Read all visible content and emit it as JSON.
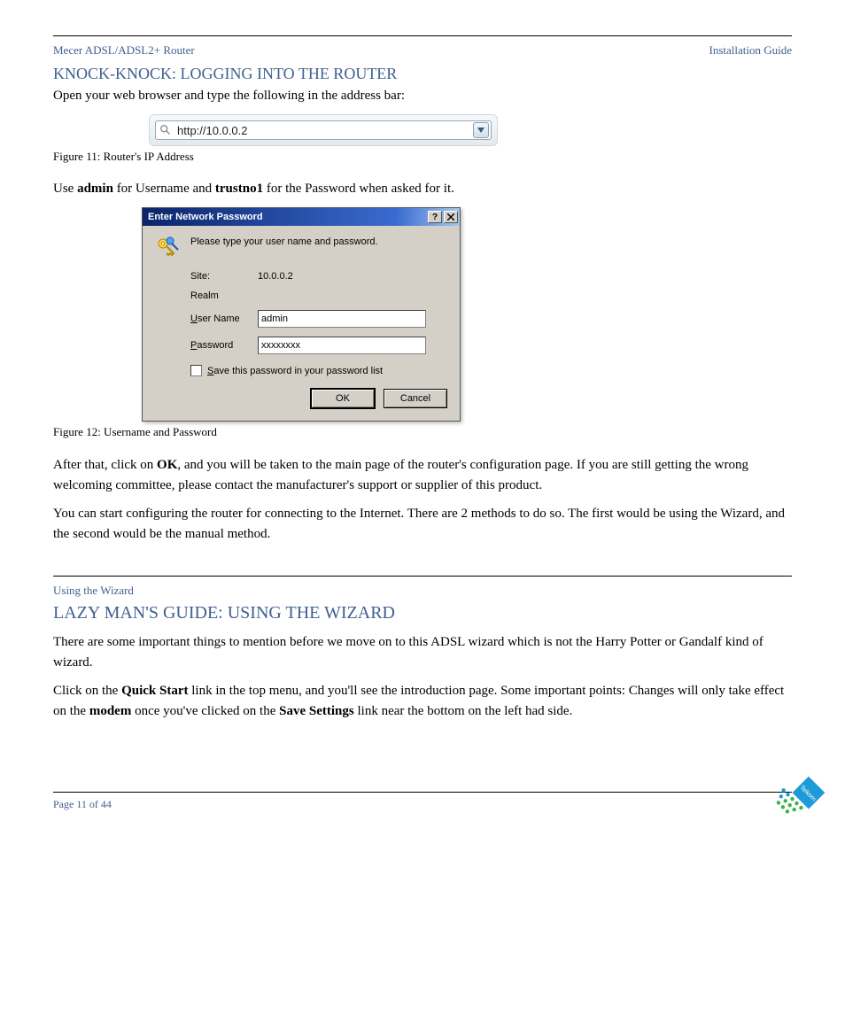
{
  "header": {
    "product": "Mecer ADSL/ADSL2+ Router",
    "doc_type": "Installation Guide"
  },
  "section1": {
    "title": "KNOCK-KNOCK: LOGGING INTO THE ROUTER",
    "intro": "Open your web browser and type the following in the address bar:",
    "addr_url": "http://10.0.0.2",
    "addr_caption": "Figure 11: Router's IP Address",
    "prompt_line_prefix": "Use ",
    "prompt_line_bold1": "admin",
    "prompt_line_mid": " for Username and ",
    "prompt_line_bold2": "trustno1",
    "prompt_line_suffix": " for the Password when asked for it.",
    "dialog": {
      "title": "Enter Network Password",
      "instruction": "Please type your user name and password.",
      "site_label": "Site:",
      "site_value": "10.0.0.2",
      "realm_label": "Realm",
      "user_label": "User Name",
      "user_value": "admin",
      "pass_label": "Password",
      "pass_value": "xxxxxxxx",
      "save_label": "Save this password in your password list",
      "ok": "OK",
      "cancel": "Cancel"
    },
    "dlg_caption": "Figure 12: Username and Password",
    "para_after_prefix": "After that, click on ",
    "para_after_bold": "OK",
    "para_after_suffix": ", and you will be taken to the main page of the router's configuration page. If you are still getting the wrong welcoming committee, please contact the manufacturer's support or supplier of this product.",
    "para2": "You can start configuring the router for connecting to the Internet. There are 2 methods to do so. The first would be using the Wizard, and the second would be the manual method."
  },
  "section2": {
    "kicker": "Using the Wizard",
    "title": "LAZY MAN'S GUIDE: USING THE WIZARD",
    "para1": "There are some important things to mention before we move on to this ADSL wizard which is not the Harry Potter or Gandalf kind of wizard.",
    "para2_prefix": "Click on the ",
    "para2_bold": "Quick Start",
    "para2_seg1": " link in the top menu, and you'll see the introduction page. Some important points: Changes will only take effect on the ",
    "para2_bold2": "modem",
    "para2_seg2": " once you've clicked on the ",
    "para2_bold3": "Save Settings",
    "para2_seg3": " link near the bottom on the left had side."
  },
  "footer": {
    "page": "Page 11 of 44",
    "logo_text": "Telkom"
  }
}
